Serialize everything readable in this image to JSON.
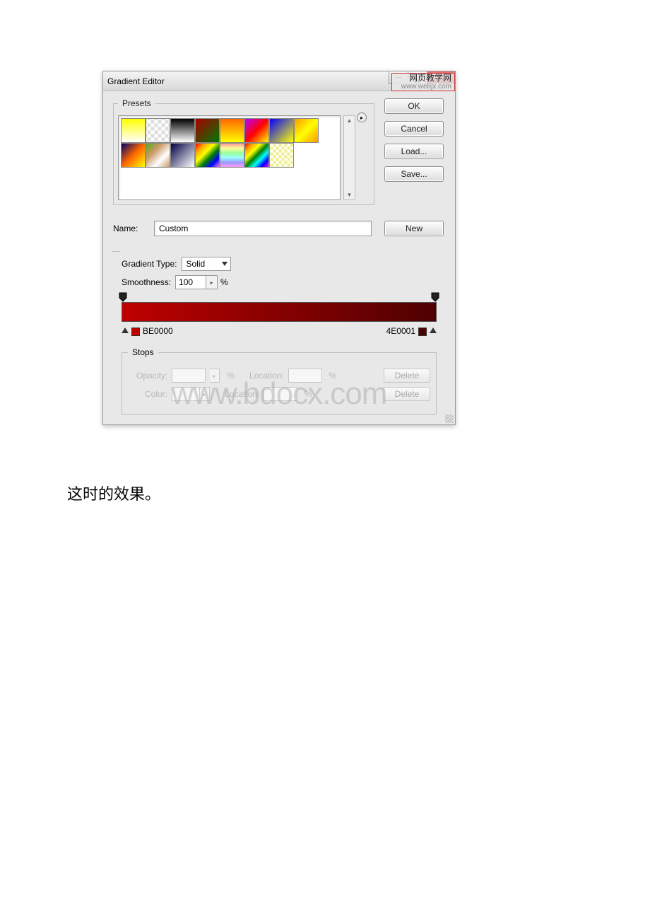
{
  "window": {
    "title": "Gradient Editor"
  },
  "watermark": {
    "line1": "网页教学网",
    "line2": "www.webjx.com"
  },
  "presets": {
    "legend": "Presets"
  },
  "buttons": {
    "ok": "OK",
    "cancel": "Cancel",
    "load": "Load...",
    "save": "Save...",
    "new": "New"
  },
  "name": {
    "label": "Name:",
    "value": "Custom"
  },
  "gradient": {
    "type_label": "Gradient Type:",
    "type_value": "Solid",
    "smoothness_label": "Smoothness:",
    "smoothness_value": "100",
    "percent": "%",
    "left_color": "BE0000",
    "right_color": "4E0001"
  },
  "stops": {
    "legend": "Stops",
    "opacity_label": "Opacity:",
    "location_label": "Location:",
    "color_label": "Color:",
    "percent": "%",
    "delete": "Delete"
  },
  "doc_watermark": "www.bdocx.com",
  "caption": "这时的效果。"
}
